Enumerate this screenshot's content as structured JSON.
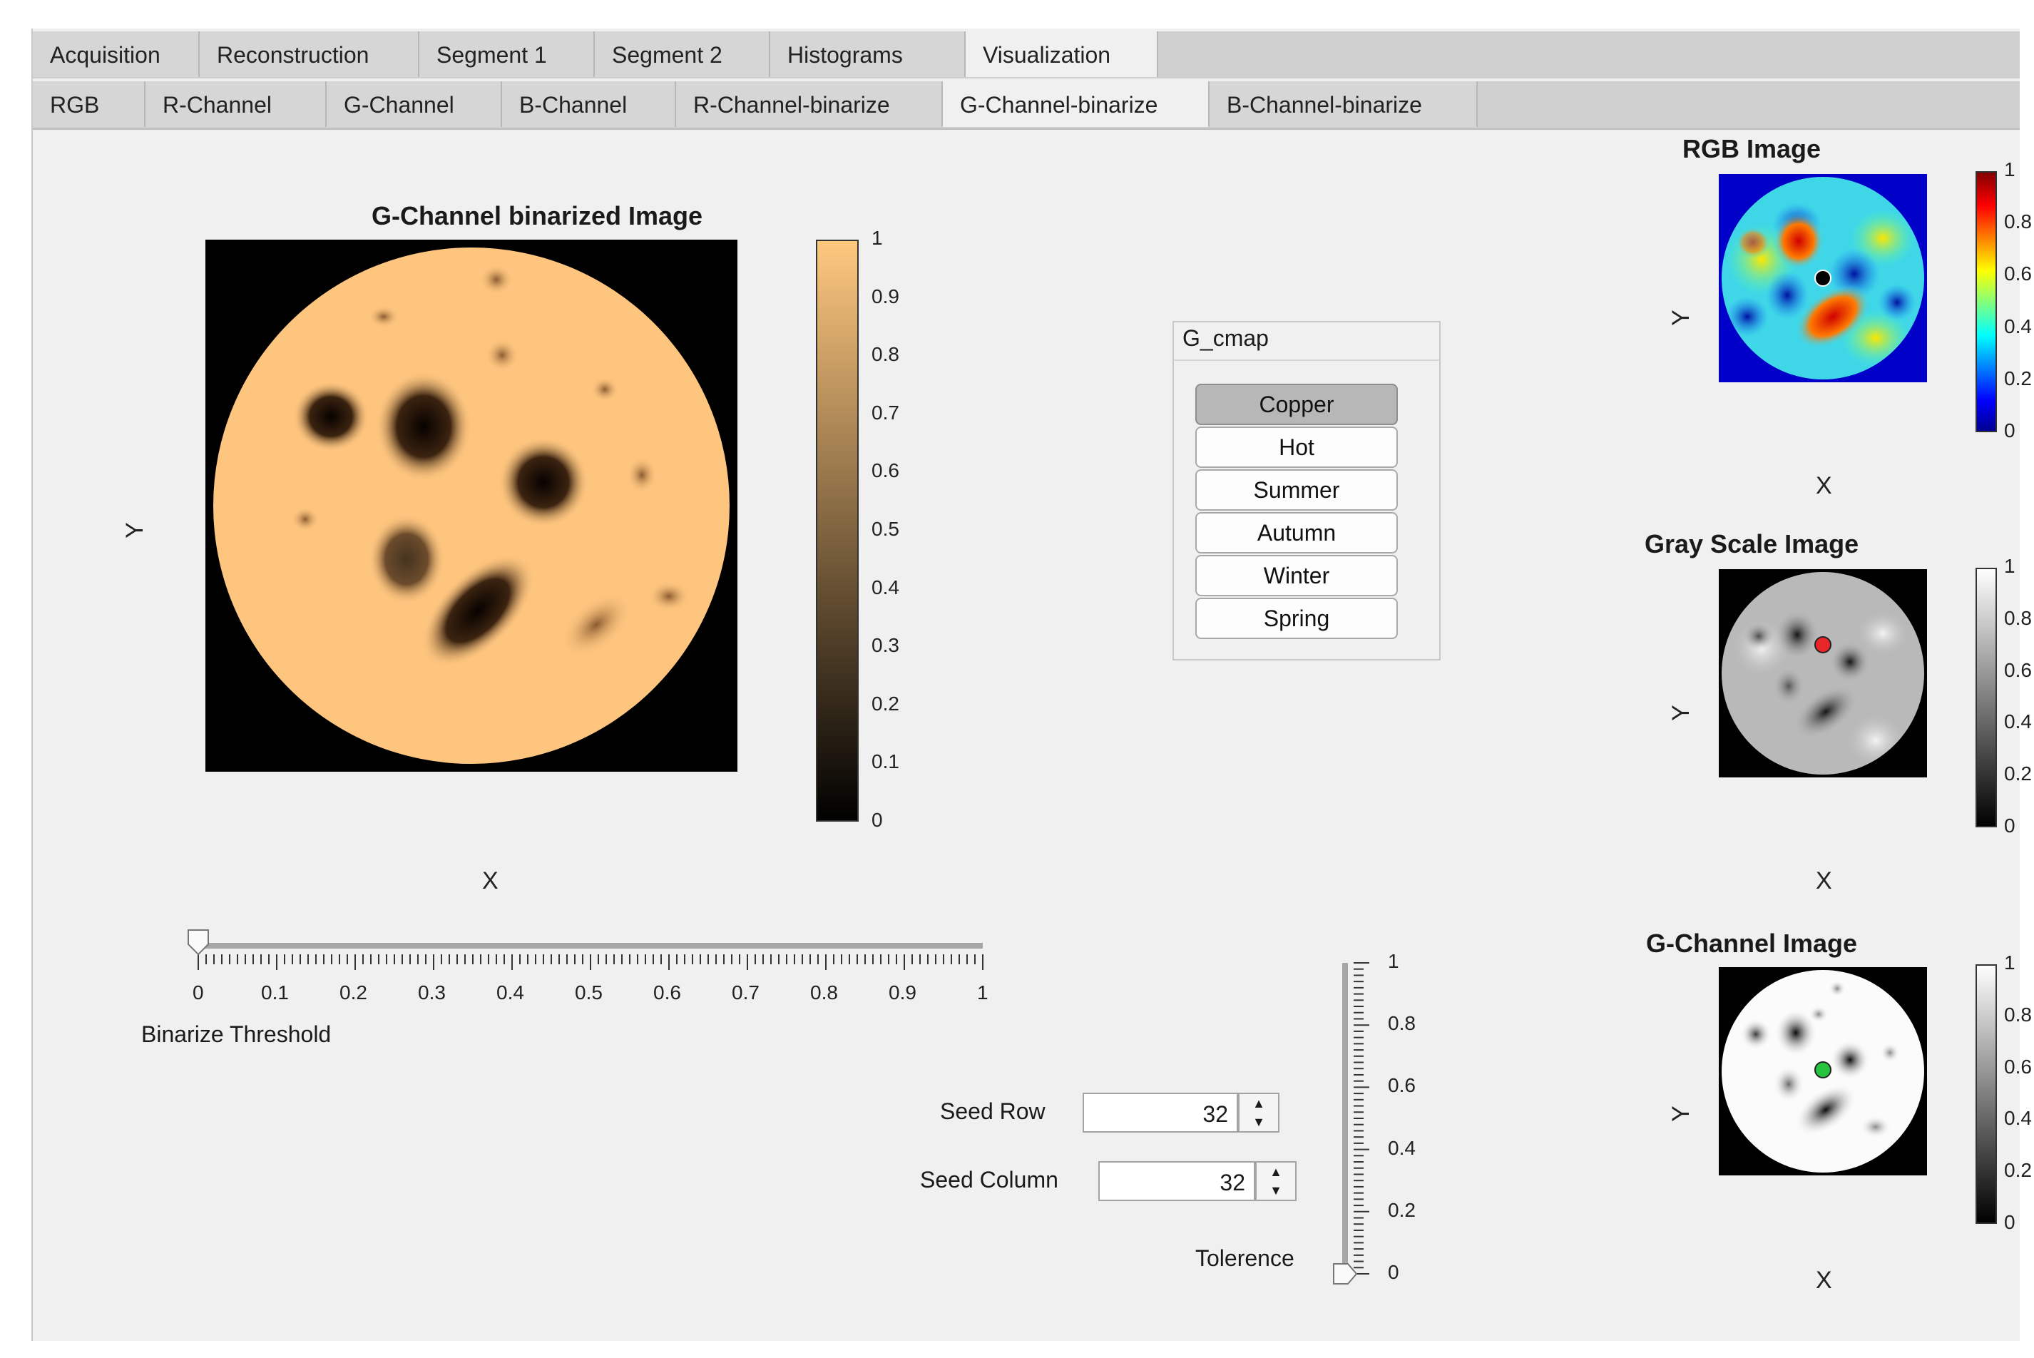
{
  "tabs": [
    "Acquisition",
    "Reconstruction",
    "Segment 1",
    "Segment 2",
    "Histograms",
    "Visualization"
  ],
  "active_tab": "Visualization",
  "subtabs": [
    "RGB",
    "R-Channel",
    "G-Channel",
    "B-Channel",
    "R-Channel-binarize",
    "G-Channel-binarize",
    "B-Channel-binarize"
  ],
  "active_subtab": "G-Channel-binarize",
  "main_plot": {
    "title": "G-Channel binarized Image",
    "xlabel": "X",
    "ylabel": "Y",
    "colorbar_ticks": [
      "0",
      "0.1",
      "0.2",
      "0.3",
      "0.4",
      "0.5",
      "0.6",
      "0.7",
      "0.8",
      "0.9",
      "1"
    ],
    "colormap_colors": [
      "#000000",
      "#ffc87f"
    ]
  },
  "cmap_panel": {
    "title": "G_cmap",
    "options": [
      "Copper",
      "Hot",
      "Summer",
      "Autumn",
      "Winter",
      "Spring"
    ],
    "selected": "Copper"
  },
  "threshold_slider": {
    "label": "Binarize Threshold",
    "ticks": [
      "0",
      "0.1",
      "0.2",
      "0.3",
      "0.4",
      "0.5",
      "0.6",
      "0.7",
      "0.8",
      "0.9",
      "1"
    ],
    "value": 0
  },
  "seed_row": {
    "label": "Seed Row",
    "value": "32"
  },
  "seed_column": {
    "label": "Seed Column",
    "value": "32"
  },
  "tolerance_slider": {
    "label": "Tolerence",
    "ticks": [
      "0",
      "0.2",
      "0.4",
      "0.6",
      "0.8",
      "1"
    ],
    "value": 0
  },
  "side_plots": [
    {
      "title": "RGB Image",
      "xlabel": "X",
      "ylabel": "Y",
      "ticks": [
        "0",
        "0.2",
        "0.4",
        "0.6",
        "0.8",
        "1"
      ],
      "marker_color": "#000000"
    },
    {
      "title": "Gray Scale Image",
      "xlabel": "X",
      "ylabel": "Y",
      "ticks": [
        "0",
        "0.2",
        "0.4",
        "0.6",
        "0.8",
        "1"
      ],
      "marker_color": "#e8262a"
    },
    {
      "title": "G-Channel Image",
      "xlabel": "X",
      "ylabel": "Y",
      "ticks": [
        "0",
        "0.2",
        "0.4",
        "0.6",
        "0.8",
        "1"
      ],
      "marker_color": "#27c43f"
    }
  ]
}
